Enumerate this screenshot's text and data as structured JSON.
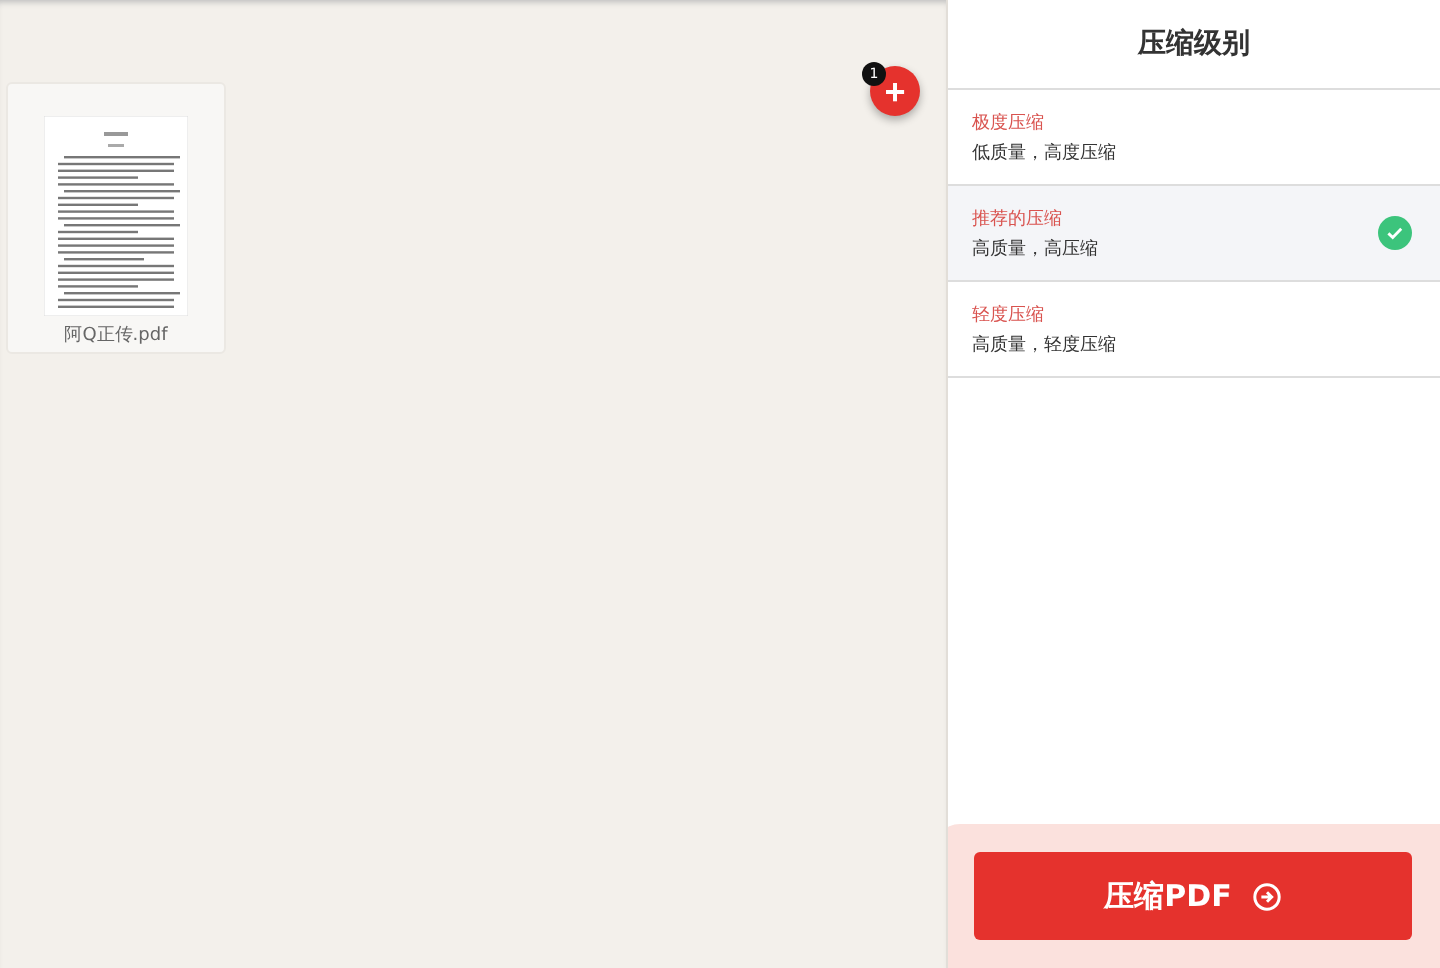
{
  "files": [
    {
      "name": "阿Q正传.pdf"
    }
  ],
  "add_button": {
    "badge": "1",
    "icon": "+"
  },
  "panel": {
    "title": "压缩级别",
    "options": [
      {
        "title": "极度压缩",
        "description": "低质量，高度压缩",
        "selected": false
      },
      {
        "title": "推荐的压缩",
        "description": "高质量，高压缩",
        "selected": true
      },
      {
        "title": "轻度压缩",
        "description": "高质量，轻度压缩",
        "selected": false
      }
    ]
  },
  "action_button": {
    "label": "压缩PDF"
  }
}
